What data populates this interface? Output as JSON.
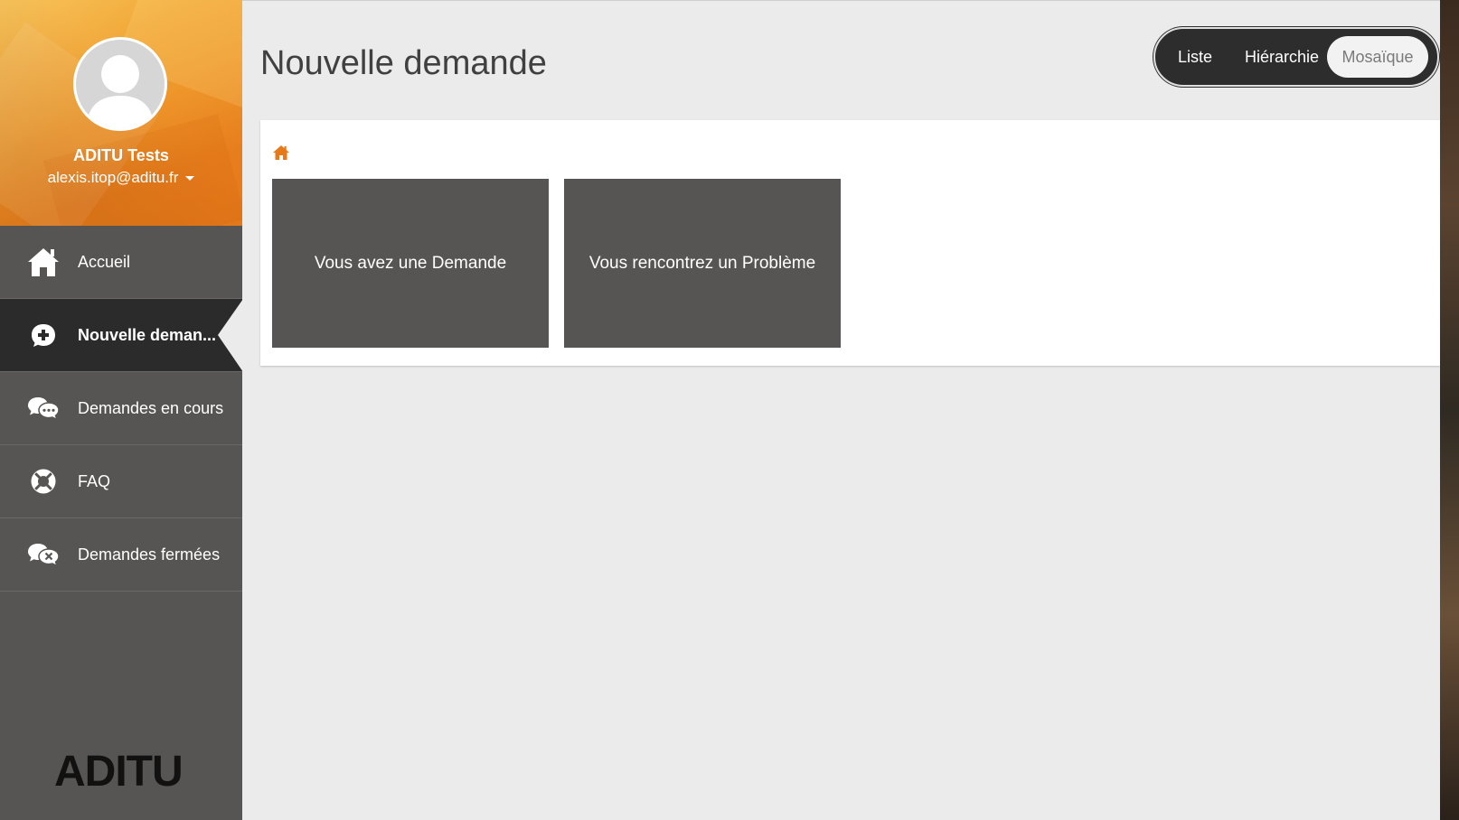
{
  "user": {
    "name": "ADITU Tests",
    "email": "alexis.itop@aditu.fr"
  },
  "nav": {
    "items": [
      {
        "label": "Accueil",
        "icon": "home-icon"
      },
      {
        "label": "Nouvelle deman...",
        "icon": "plus-circle-icon",
        "active": true
      },
      {
        "label": "Demandes en cours",
        "icon": "chat-bubbles-icon"
      },
      {
        "label": "FAQ",
        "icon": "lifebuoy-icon"
      },
      {
        "label": "Demandes fermées",
        "icon": "chat-closed-icon"
      }
    ]
  },
  "brand": {
    "logo_text": "ADITU"
  },
  "page": {
    "title": "Nouvelle demande"
  },
  "view_switch": {
    "options": [
      "Liste",
      "Hiérarchie",
      "Mosaïque"
    ],
    "selected": "Mosaïque"
  },
  "breadcrumb": {
    "home_icon": "home-icon"
  },
  "tiles": [
    {
      "label": "Vous avez une Demande"
    },
    {
      "label": "Vous rencontrez un Problème"
    }
  ],
  "colors": {
    "accent": "#e67a1a",
    "sidebar": "#575553",
    "sidebar_active": "#2b2b2b",
    "tile": "#575553",
    "background": "#ebebeb"
  }
}
